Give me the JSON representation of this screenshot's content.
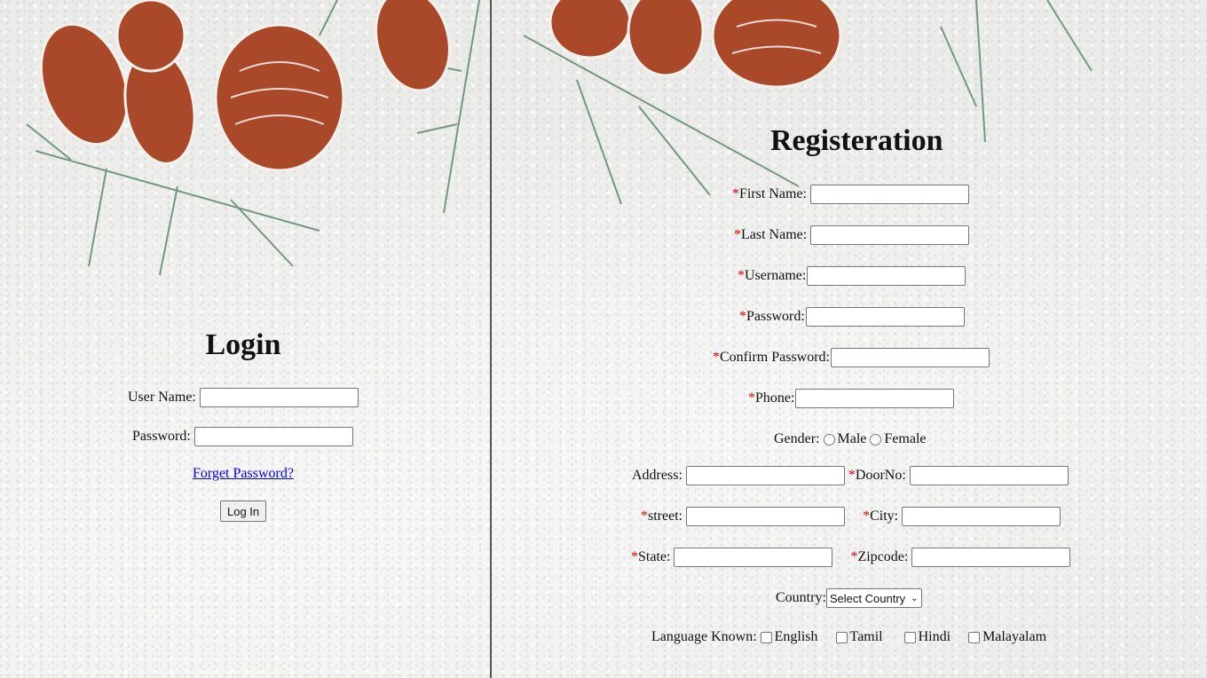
{
  "login": {
    "title": "Login",
    "username_label": "User Name:",
    "username_value": "",
    "password_label": "Password:",
    "password_value": "",
    "forgot_link": "Forget Password?",
    "login_button": "Log In"
  },
  "register": {
    "title": "Registeration",
    "required_mark": "*",
    "first_name_label": "First Name:",
    "last_name_label": "Last Name:",
    "username_label": "Username:",
    "password_label": "Password:",
    "confirm_password_label": "Confirm Password:",
    "phone_label": "Phone:",
    "gender_label": "Gender:",
    "gender_options": [
      "Male",
      "Female"
    ],
    "address_label": "Address:",
    "doorno_label": "DoorNo:",
    "street_label": "street:",
    "city_label": "City:",
    "state_label": "State:",
    "zipcode_label": "Zipcode:",
    "country_label": "Country:",
    "country_selected": "Select Country",
    "language_label": "Language Known:",
    "languages": [
      "English",
      "Tamil",
      "Hindi",
      "Malayalam"
    ]
  },
  "colors": {
    "required": "#e00000",
    "link": "#0000ee",
    "divider": "#555555"
  },
  "icons": [
    "pine-cone-decoration",
    "chevron-down-icon"
  ]
}
